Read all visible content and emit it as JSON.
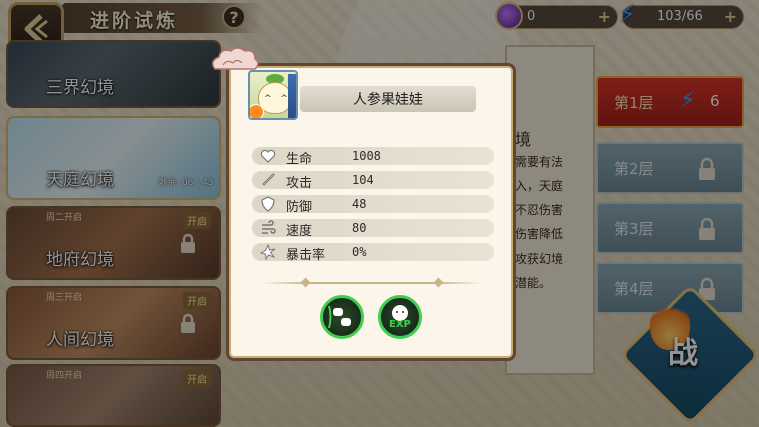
{
  "header": {
    "title": "进阶试炼",
    "help_label": "?",
    "gem_count": "0",
    "stamina": "103/66",
    "plus": "+"
  },
  "realms": [
    {
      "name": "三界幻境"
    },
    {
      "name": "天庭幻境",
      "rest_text": "剩余: 08 : 43"
    },
    {
      "name": "地府幻境",
      "day_tag": "周二开启",
      "open_label": "开启"
    },
    {
      "name": "人间幻境",
      "day_tag": "周三开启",
      "open_label": "开启"
    },
    {
      "day_tag": "周四开启",
      "open_label": "开启"
    }
  ],
  "floors": [
    {
      "label": "第1层",
      "cost": "6"
    },
    {
      "label": "第2层"
    },
    {
      "label": "第3层"
    },
    {
      "label": "第4层"
    }
  ],
  "fight_label": "战",
  "background_text": [
    "境",
    "需要有法",
    "入，天庭",
    "不忍伤害",
    "伤害降低",
    "攻获幻境",
    "潜能。"
  ],
  "modal": {
    "character_name": "人参果娃娃",
    "stats": [
      {
        "label": "生命",
        "value": "1008",
        "icon": "heart-icon"
      },
      {
        "label": "攻击",
        "value": "104",
        "icon": "sword-icon"
      },
      {
        "label": "防御",
        "value": "48",
        "icon": "shield-icon"
      },
      {
        "label": "速度",
        "value": "80",
        "icon": "wind-icon"
      },
      {
        "label": "暴击率",
        "value": "0%",
        "icon": "burst-icon"
      }
    ],
    "skills": [
      {
        "icon": "fist-skill-icon"
      },
      {
        "icon": "exp-skill-icon",
        "text": "EXP"
      }
    ]
  },
  "colors": {
    "accent_red": "#d8372a",
    "skill_ring": "#3ecf4f",
    "modal_border": "#5e4630"
  }
}
